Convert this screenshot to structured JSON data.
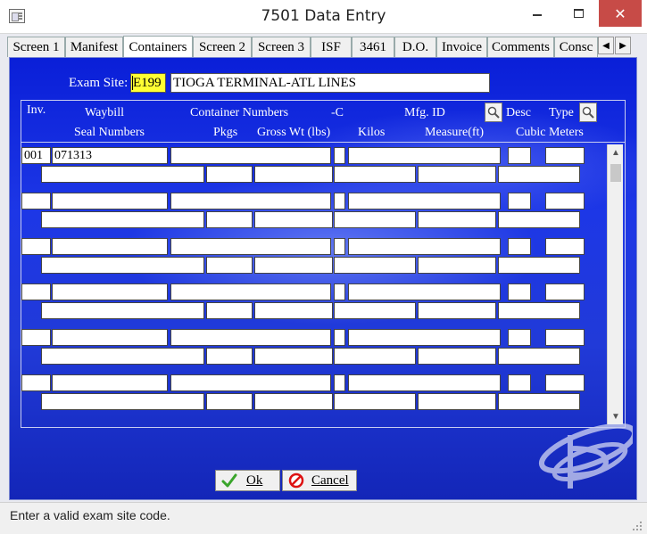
{
  "window": {
    "title": "7501 Data Entry"
  },
  "tabs": [
    {
      "label": "Screen 1",
      "w": 65
    },
    {
      "label": "Manifest",
      "w": 65
    },
    {
      "label": "Containers",
      "w": 78,
      "active": true
    },
    {
      "label": "Screen 2",
      "w": 66
    },
    {
      "label": "Screen 3",
      "w": 66
    },
    {
      "label": "ISF",
      "w": 46
    },
    {
      "label": "3461",
      "w": 48
    },
    {
      "label": "D.O.",
      "w": 47
    },
    {
      "label": "Invoice",
      "w": 57
    },
    {
      "label": "Comments",
      "w": 75
    },
    {
      "label": "Consc",
      "w": 49
    }
  ],
  "exam_site": {
    "label": "Exam Site:",
    "code": "E199",
    "name": "TIOGA TERMINAL-ATL LINES"
  },
  "headers": {
    "row1": {
      "inv": "Inv.",
      "waybill": "Waybill",
      "container_numbers": "Container Numbers",
      "c": "-C",
      "mfg_id": "Mfg. ID",
      "desc": "Desc",
      "type": "Type"
    },
    "row2": {
      "seal_numbers": "Seal Numbers",
      "pkgs": "Pkgs",
      "gross_wt": "Gross Wt (lbs)",
      "kilos": "Kilos",
      "measure": "Measure(ft)",
      "cubic_meters": "Cubic Meters"
    }
  },
  "rows": [
    {
      "inv": "001",
      "waybill": "071313"
    },
    {
      "inv": "",
      "waybill": ""
    },
    {
      "inv": "",
      "waybill": ""
    },
    {
      "inv": "",
      "waybill": ""
    },
    {
      "inv": "",
      "waybill": ""
    },
    {
      "inv": "",
      "waybill": ""
    }
  ],
  "buttons": {
    "ok": "Ok",
    "cancel": "Cancel"
  },
  "status": {
    "text": "Enter a valid exam site code."
  },
  "colors": {
    "panel_blue": "#1d37e6",
    "highlight": "#ffff33",
    "close_red": "#c74b47"
  },
  "icons": [
    "app-icon",
    "search-icon",
    "check-icon",
    "cancel-icon",
    "scroll-up-icon",
    "scroll-down-icon",
    "resize-grip-icon"
  ]
}
